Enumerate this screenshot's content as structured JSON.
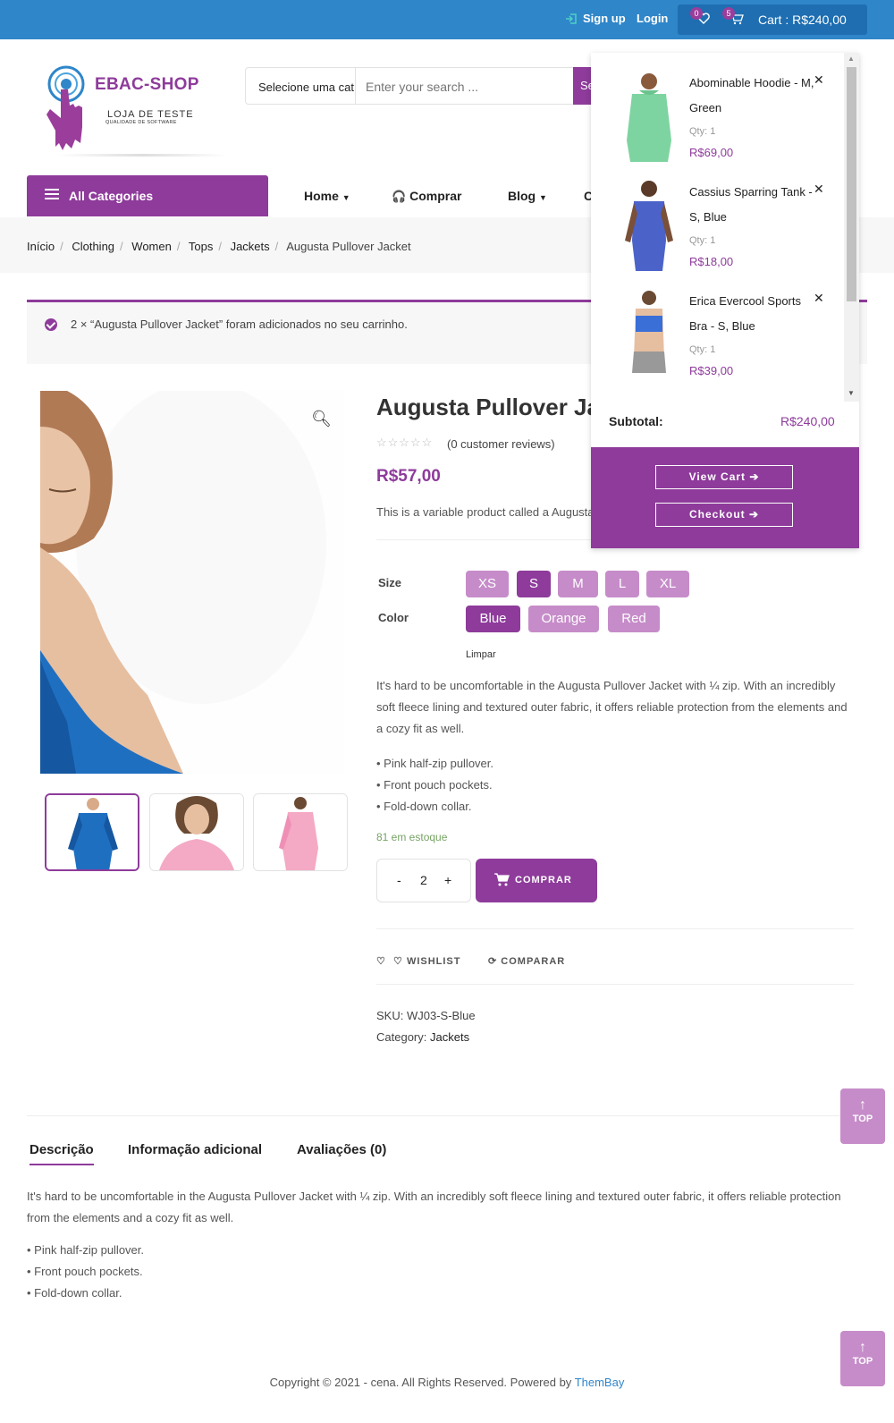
{
  "topbar": {
    "signup": "Sign up",
    "login": "Login",
    "wishlist_count": "0",
    "cart_count": "5",
    "cart_label": "Cart : R$240,00"
  },
  "logo": {
    "brand": "EBAC-SHOP",
    "tagline": "LOJA DE TESTE",
    "tagline_small": "QUALIDADE DE SOFTWARE"
  },
  "search": {
    "category": "Selecione uma cat",
    "placeholder": "Enter your search ...",
    "button_label": "Se"
  },
  "nav": {
    "all_categories": "All Categories",
    "items": [
      "Home",
      "Comprar",
      "Blog",
      "C"
    ]
  },
  "breadcrumb": {
    "items": [
      "Início",
      "Clothing",
      "Women",
      "Tops",
      "Jackets"
    ],
    "current": "Augusta Pullover Jacket"
  },
  "notice": {
    "message": "2 × “Augusta Pullover Jacket” foram adicionados no seu carrinho."
  },
  "product": {
    "title": "Augusta Pullover Jacket",
    "reviews": "(0 customer reviews)",
    "price": "R$57,00",
    "short_description": "This is a variable product called a Augusta Pullover Jacket",
    "size_label": "Size",
    "sizes": [
      "XS",
      "S",
      "M",
      "L",
      "XL"
    ],
    "selected_size": "S",
    "color_label": "Color",
    "colors": [
      "Blue",
      "Orange",
      "Red"
    ],
    "selected_color": "Blue",
    "clear_label": "Limpar",
    "description": "It's hard to be uncomfortable in the Augusta Pullover Jacket with ¼ zip. With an incredibly soft fleece lining and textured outer fabric, it offers reliable protection from the elements and a cozy fit as well.",
    "bullets": [
      "• Pink half-zip pullover.",
      "• Front pouch pockets.",
      "• Fold-down collar."
    ],
    "stock": "81 em estoque",
    "quantity": "2",
    "buy_label": "COMPRAR",
    "wishlist_label": "WISHLIST",
    "compare_label": "COMPARAR",
    "sku_label": "SKU:",
    "sku": "WJ03-S-Blue",
    "category_label": "Category:",
    "category": "Jackets"
  },
  "tabs": {
    "items": [
      "Descrição",
      "Informação adicional",
      "Avaliações (0)"
    ],
    "description": "It's hard to be uncomfortable in the Augusta Pullover Jacket with ¼ zip. With an incredibly soft fleece lining and textured outer fabric, it offers reliable protection from the elements and a cozy fit as well.",
    "bullets": [
      "• Pink half-zip pullover.",
      "• Front pouch pockets.",
      "• Fold-down collar."
    ]
  },
  "footer": {
    "copyright": "Copyright © 2021 - cena. All Rights Reserved. Powered by ",
    "link": "ThemBay"
  },
  "totop_label": "TOP",
  "minicart": {
    "items": [
      {
        "name": "Abominable Hoodie - M, Green",
        "qty": "Qty: 1",
        "price": "R$69,00"
      },
      {
        "name": "Cassius Sparring Tank - S, Blue",
        "qty": "Qty: 1",
        "price": "R$18,00"
      },
      {
        "name": "Erica Evercool Sports Bra - S, Blue",
        "qty": "Qty: 1",
        "price": "R$39,00"
      }
    ],
    "subtotal_label": "Subtotal:",
    "subtotal": "R$240,00",
    "view_cart": "View Cart ➔",
    "checkout": "Checkout ➔"
  },
  "colors": {
    "brand_purple": "#8e3b9b",
    "swatch_light": "#c68cc9",
    "topbar_blue": "#2f86c9"
  }
}
